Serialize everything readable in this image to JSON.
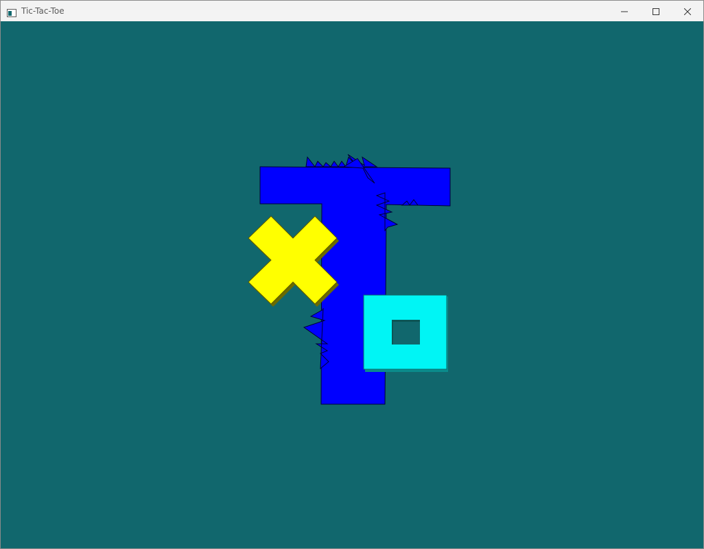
{
  "window": {
    "title": "Tic-Tac-Toe",
    "app_icon": "window-app-icon",
    "controls": [
      "minimize-icon",
      "maximize-icon",
      "close-icon"
    ]
  },
  "scene": {
    "background": "#11676d",
    "logo_letter_color": "#0000ff",
    "x_piece_color": "#ffff00",
    "x_piece_shadow": "#6b6b00",
    "o_piece_color": "#00f5f5",
    "o_piece_shadow": "#0b8c8c"
  }
}
